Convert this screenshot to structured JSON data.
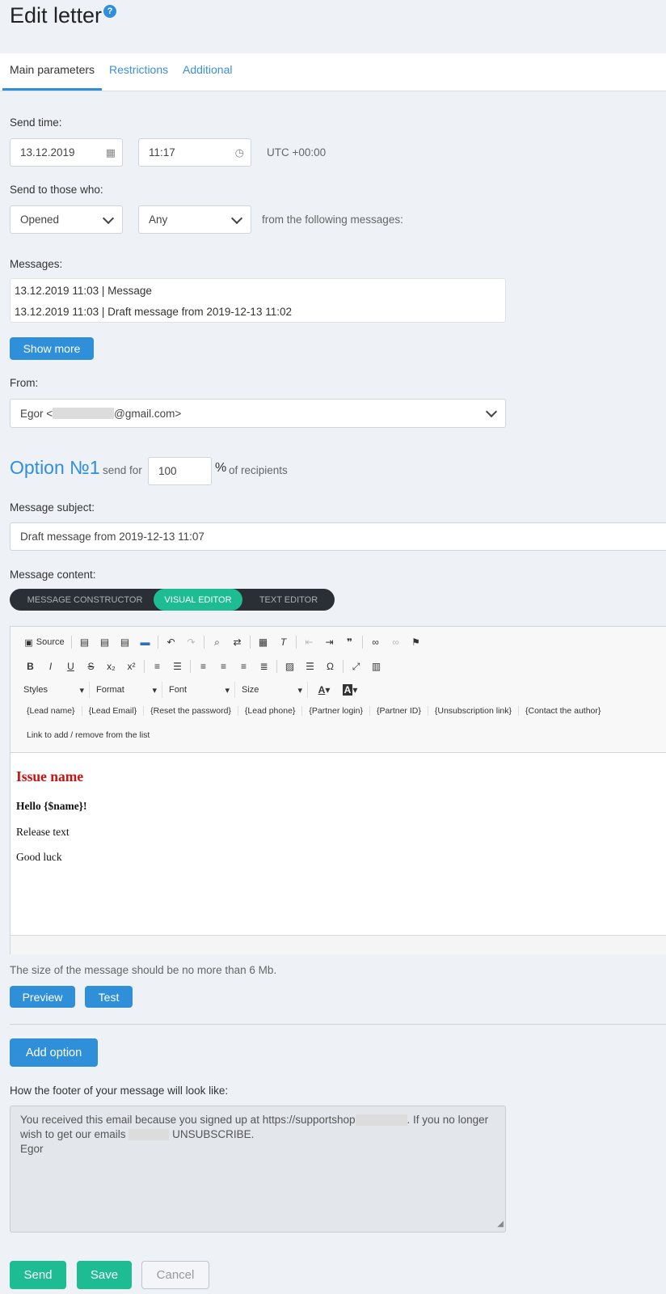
{
  "header": {
    "title": "Edit letter",
    "help_icon": "?"
  },
  "tabs": [
    {
      "label": "Main parameters",
      "active": true
    },
    {
      "label": "Restrictions",
      "active": false
    },
    {
      "label": "Additional",
      "active": false
    }
  ],
  "send_time": {
    "label": "Send time:",
    "date": "13.12.2019",
    "time": "11:17",
    "timezone": "UTC +00:00"
  },
  "send_to": {
    "label": "Send to those who:",
    "condition": "Opened",
    "scope": "Any",
    "suffix": "from the following messages:"
  },
  "messages": {
    "label": "Messages:",
    "items": [
      "13.12.2019 11:03 | Message",
      "13.12.2019 11:03 | Draft message from 2019-12-13 11:02"
    ],
    "show_more": "Show more"
  },
  "from": {
    "label": "From:",
    "name_prefix": "Egor <",
    "email_suffix": "@gmail.com>"
  },
  "option": {
    "title": "Option №1",
    "send_for": "send for",
    "percent": "100",
    "percent_sign": "%",
    "recipients": "of recipients"
  },
  "subject": {
    "label": "Message subject:",
    "value": "Draft message from 2019-12-13 11:07"
  },
  "content": {
    "label": "Message content:",
    "modes": [
      {
        "label": "MESSAGE CONSTRUCTOR",
        "active": false
      },
      {
        "label": "VISUAL EDITOR",
        "active": true
      },
      {
        "label": "TEXT EDITOR",
        "active": false
      }
    ]
  },
  "toolbar": {
    "source": "Source",
    "combos": [
      "Styles",
      "Format",
      "Font",
      "Size"
    ],
    "macros": [
      "{Lead name}",
      "{Lead Email}",
      "{Reset the password}",
      "{Lead phone}",
      "{Partner login}",
      "{Partner ID}",
      "{Unsubscription link}",
      "{Contact the author}"
    ],
    "link_list": "Link to add / remove from the list"
  },
  "editor_body": {
    "heading": "Issue name",
    "greeting": "Hello {$name}!",
    "paragraph1": "Release text",
    "paragraph2": "Good luck"
  },
  "size_note": "The size of the message should be no more than 6 Mb.",
  "buttons": {
    "preview": "Preview",
    "test": "Test",
    "add_option": "Add option",
    "send": "Send",
    "save": "Save",
    "cancel": "Cancel"
  },
  "footer": {
    "label": "How the footer of your message will look like:",
    "line1_prefix": "You received this email because you signed up at https://supportshop",
    "line1_suffix": ". If you no longer",
    "line2_prefix": "wish to get our emails",
    "line2_suffix": "UNSUBSCRIBE.",
    "line3": "Egor"
  },
  "colors": {
    "accent_blue": "#2f8fd9",
    "accent_green": "#1ebc93",
    "heading_red": "#cc1111"
  }
}
